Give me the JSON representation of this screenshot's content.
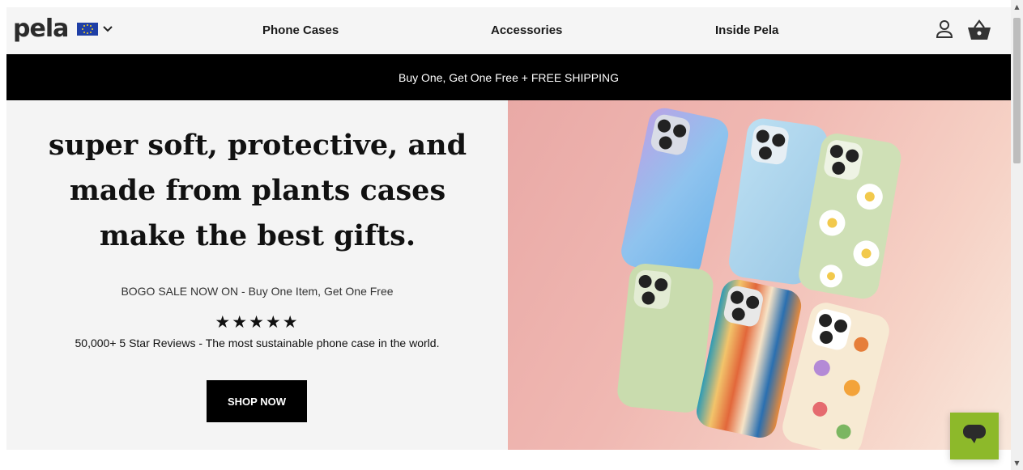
{
  "brand": {
    "logo_text": "pela"
  },
  "header": {
    "region_flag": "eu-flag-icon",
    "nav": [
      {
        "label": "Phone Cases"
      },
      {
        "label": "Accessories"
      },
      {
        "label": "Inside Pela"
      }
    ],
    "account_icon": "user-icon",
    "cart_icon": "basket-icon"
  },
  "promo": {
    "text": "Buy One, Get One Free + FREE SHIPPING"
  },
  "hero": {
    "title": "super soft, protective, and made from plants cases make the best gifts.",
    "sale_text": "BOGO SALE NOW ON - Buy One Item, Get One Free",
    "rating_stars": "★★★★★",
    "rating": 5,
    "reviews_text": "50,000+ 5 Star Reviews - The most sustainable phone case in the world.",
    "cta_label": "SHOP NOW"
  },
  "chat": {
    "icon": "chat-bubble-icon"
  },
  "colors": {
    "header_bg": "#f5f5f5",
    "promo_bg": "#000000",
    "hero_bg": "#f4f4f4",
    "cta_bg": "#000000",
    "chat_bg": "#8db92a"
  }
}
